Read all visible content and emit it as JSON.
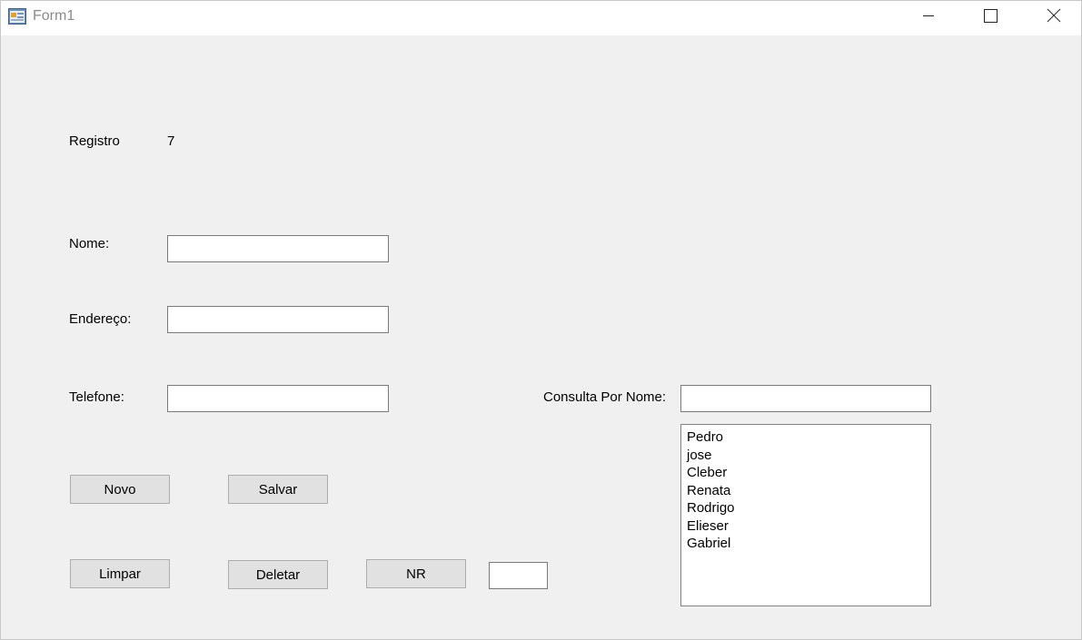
{
  "window": {
    "title": "Form1"
  },
  "form": {
    "registro_label": "Registro",
    "registro_value": "7",
    "nome_label": "Nome:",
    "nome_value": "",
    "endereco_label": "Endereço:",
    "endereco_value": "",
    "telefone_label": "Telefone:",
    "telefone_value": "",
    "consulta_label": "Consulta Por Nome:",
    "consulta_value": "",
    "nr_value": ""
  },
  "buttons": {
    "novo": "Novo",
    "salvar": "Salvar",
    "limpar": "Limpar",
    "deletar": "Deletar",
    "nr": "NR"
  },
  "names_list": [
    "Pedro",
    "jose",
    "Cleber",
    "Renata",
    "Rodrigo",
    "Elieser",
    "Gabriel"
  ],
  "icons": {
    "app": "form-app-icon",
    "minimize": "minimize-icon",
    "maximize": "maximize-icon",
    "close": "close-icon"
  }
}
